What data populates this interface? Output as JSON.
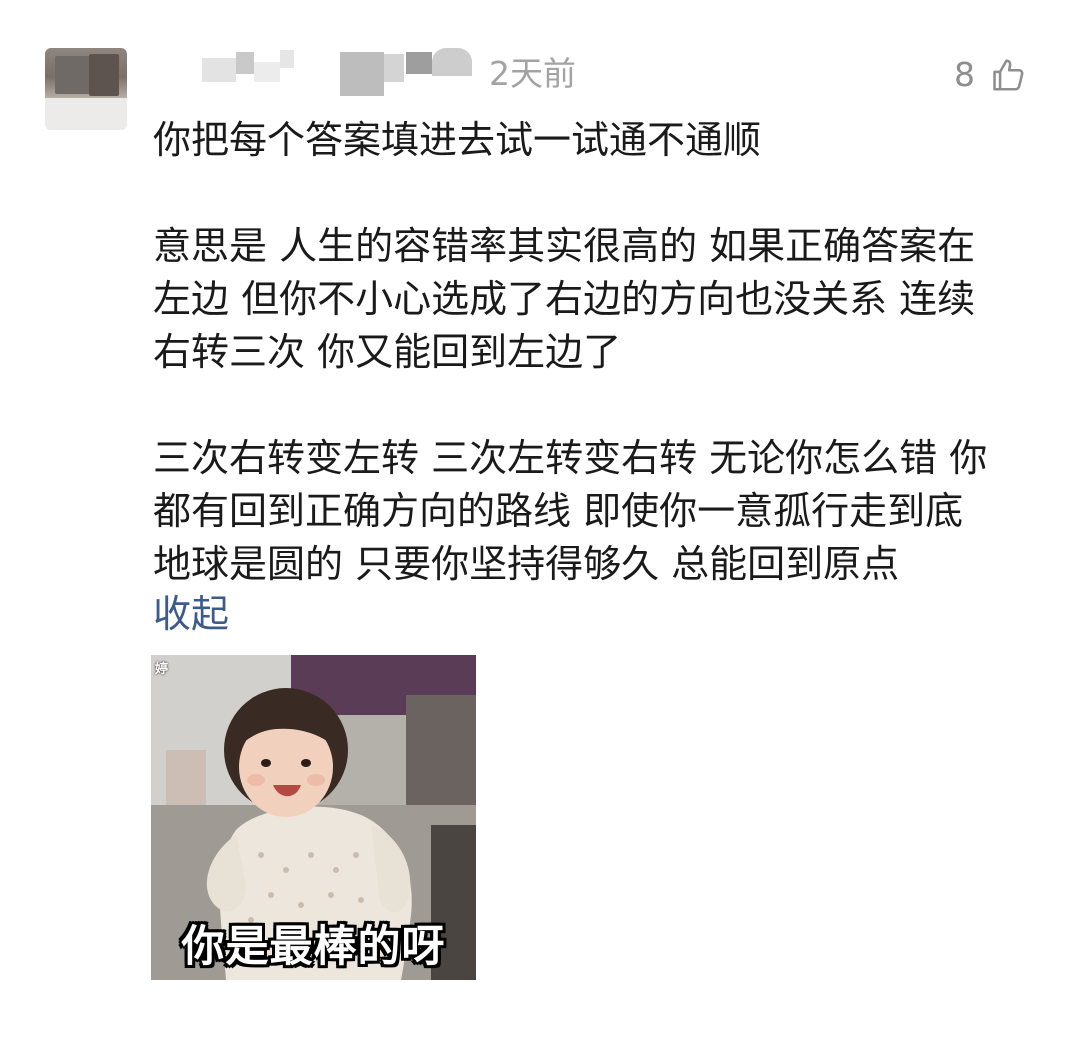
{
  "comment": {
    "time": "2天前",
    "like_count": "8",
    "paragraphs": [
      [
        "你把每个答案填进去试一试通不通顺"
      ],
      [
        "意思是 人生的容错率其实很高的 如果正确答案在",
        "左边 但你不小心选成了右边的方向也没关系 连续",
        "右转三次 你又能回到左边了"
      ],
      [
        "三次右转变左转 三次左转变右转 无论你怎么错 你",
        "都有回到正确方向的路线 即使你一意孤行走到底",
        "地球是圆的 只要你坚持得够久 总能回到原点"
      ]
    ],
    "collapse_label": "收起",
    "sticker": {
      "caption": "你是最棒的呀",
      "watermark": "婷"
    }
  },
  "icons": {
    "like": "thumbs-up-icon"
  },
  "colors": {
    "time": "#a3a3a3",
    "like_count": "#8e8e8e",
    "text": "#1a1a1a",
    "collapse_link": "#3d5b8a"
  }
}
